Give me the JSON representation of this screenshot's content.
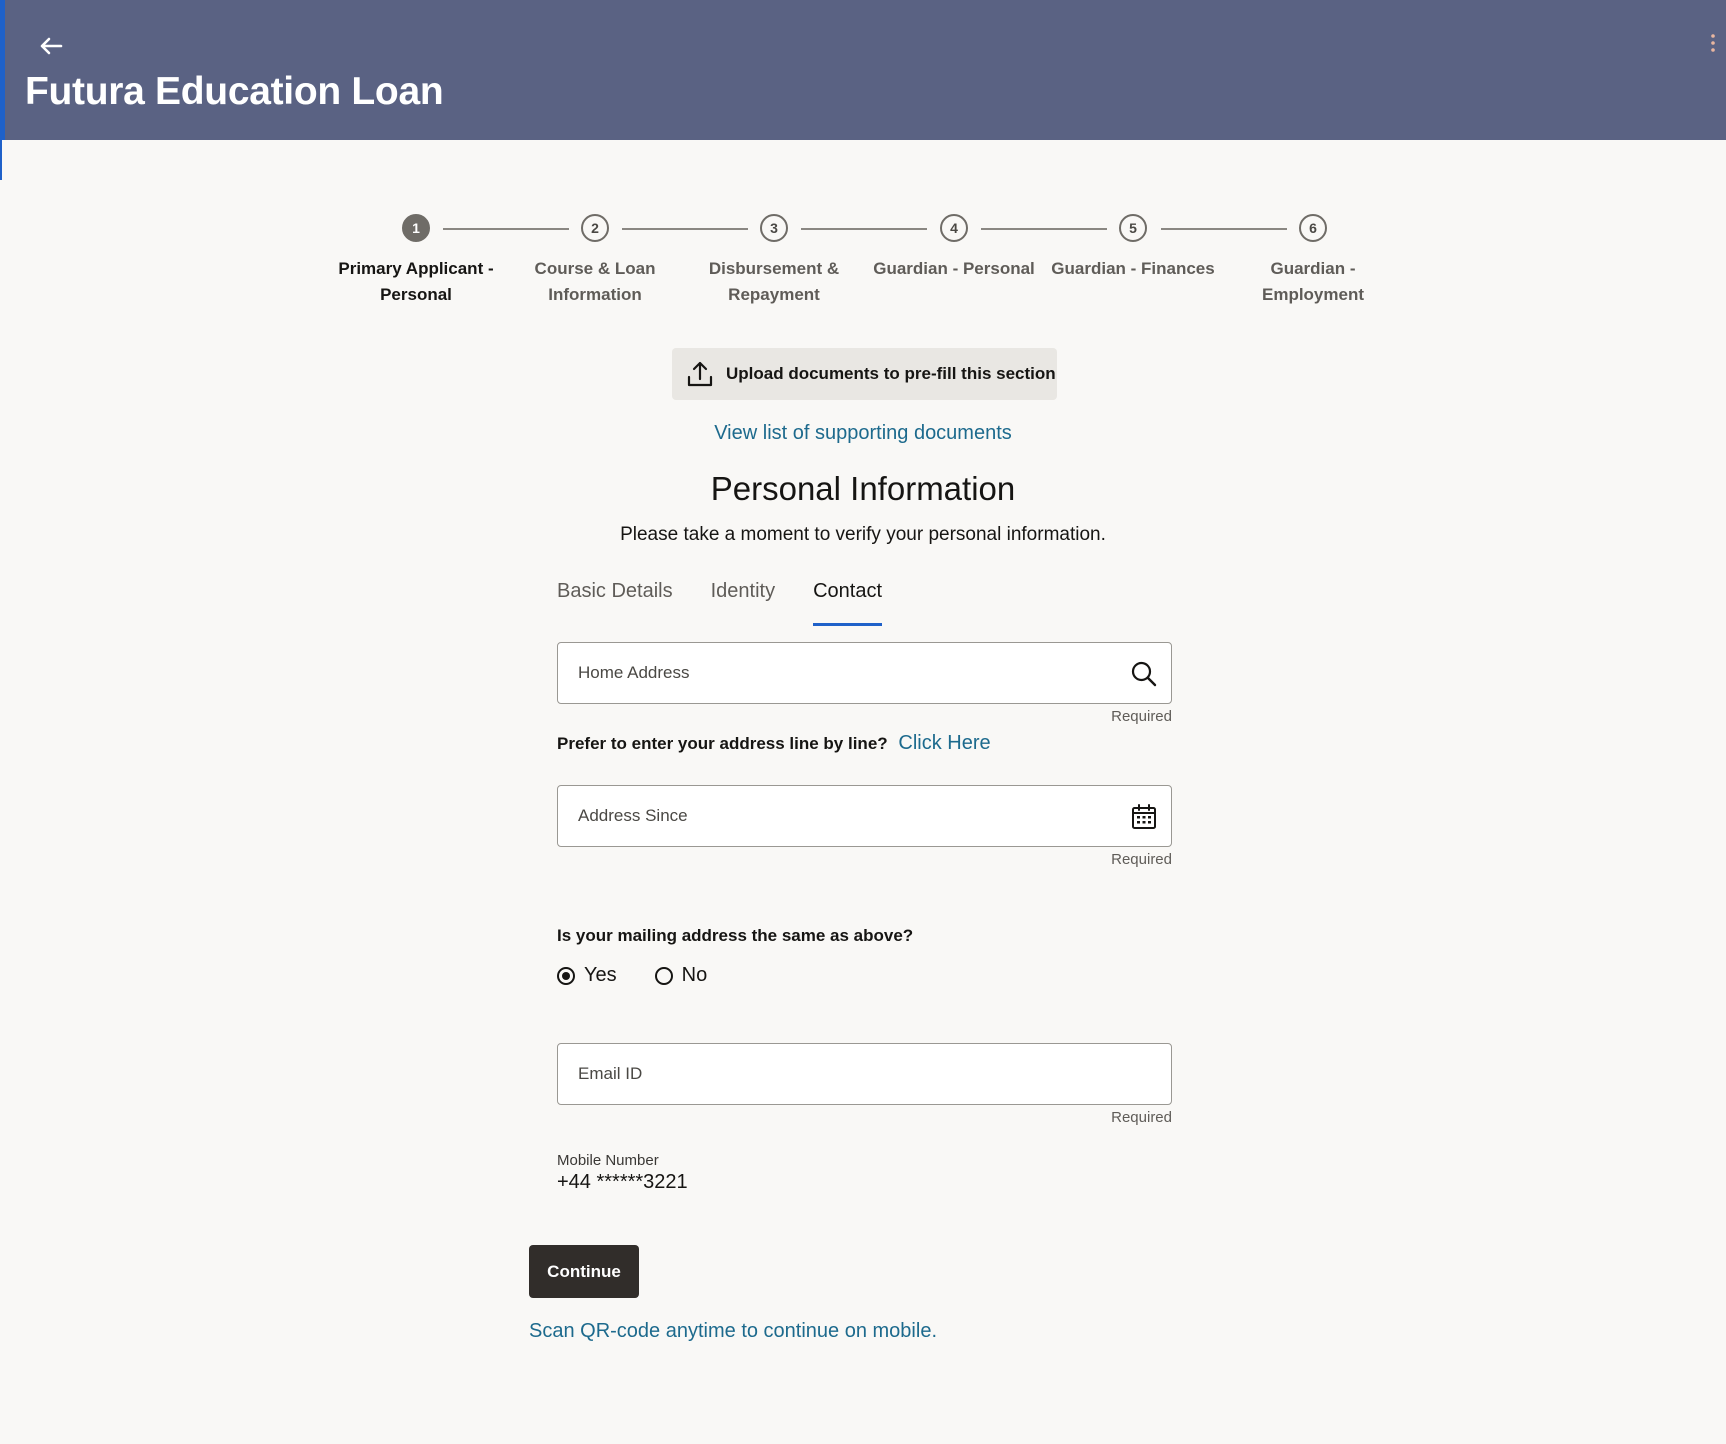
{
  "app": {
    "title": "Futura Education Loan",
    "back_icon": "arrow-left-icon",
    "menu_icon": "kebab-menu-icon"
  },
  "stepper": {
    "current_step": 1,
    "steps": [
      {
        "number": "1",
        "line1": "Primary Applicant -",
        "line2": "Personal"
      },
      {
        "number": "2",
        "line1": "Course & Loan",
        "line2": "Information"
      },
      {
        "number": "3",
        "line1": "Disbursement &",
        "line2": "Repayment"
      },
      {
        "number": "4",
        "line1": "Guardian - Personal",
        "line2": ""
      },
      {
        "number": "5",
        "line1": "Guardian - Finances",
        "line2": ""
      },
      {
        "number": "6",
        "line1": "Guardian -",
        "line2": "Employment"
      }
    ]
  },
  "upload": {
    "label": "Upload documents to pre-fill this section",
    "icon": "upload-icon"
  },
  "view_docs_link": "View list of supporting documents",
  "section": {
    "title": "Personal Information",
    "subtitle": "Please take a moment to verify your personal information."
  },
  "tabs": [
    {
      "label": "Basic Details",
      "active": false
    },
    {
      "label": "Identity",
      "active": false
    },
    {
      "label": "Contact",
      "active": true
    }
  ],
  "form": {
    "home_address": {
      "placeholder": "Home Address",
      "value": "",
      "helper": "Required",
      "icon": "search-icon"
    },
    "line_by_line": {
      "prompt": "Prefer to enter your address line by line?",
      "link": "Click Here"
    },
    "address_since": {
      "placeholder": "Address Since",
      "value": "",
      "helper": "Required",
      "icon": "calendar-icon"
    },
    "mailing_same": {
      "question": "Is your mailing address the same as above?",
      "options": [
        {
          "label": "Yes",
          "checked": true
        },
        {
          "label": "No",
          "checked": false
        }
      ]
    },
    "email": {
      "placeholder": "Email ID",
      "value": "",
      "helper": "Required"
    },
    "mobile": {
      "label": "Mobile Number",
      "value": "+44 ******3221"
    }
  },
  "continue_label": "Continue",
  "qr_link": "Scan QR-code anytime to continue on mobile.",
  "colors": {
    "header_bg": "#5a6283",
    "accent_blue": "#1f61c9",
    "link": "#1d6a8d",
    "primary_button": "#312d2a",
    "page_bg": "#f9f8f6"
  }
}
